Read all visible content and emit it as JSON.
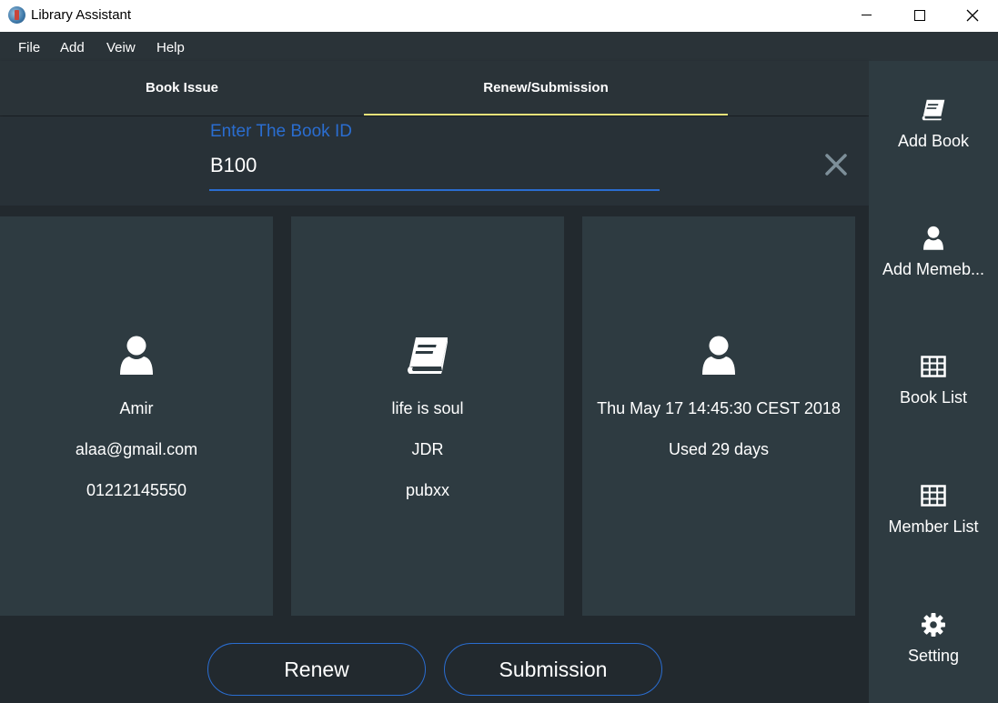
{
  "window": {
    "title": "Library Assistant"
  },
  "menu": {
    "file": "File",
    "add": "Add",
    "view": "Veiw",
    "help": "Help"
  },
  "tabs": {
    "issue": "Book Issue",
    "renew": "Renew/Submission",
    "active": "Renew/Submission"
  },
  "book_id": {
    "label": "Enter The Book ID",
    "value": "B100"
  },
  "member_card": {
    "icon": "user-icon",
    "name": "Amir",
    "email": "alaa@gmail.com",
    "phone": "01212145550"
  },
  "book_card": {
    "icon": "book-icon",
    "title": "life is soul",
    "author": "JDR",
    "publisher": "pubxx"
  },
  "issue_card": {
    "icon": "user-icon",
    "issue_date": "Thu May 17 14:45:30 CEST 2018",
    "days_used": "Used 29 days"
  },
  "buttons": {
    "renew": "Renew",
    "submission": "Submission"
  },
  "sidebar": {
    "items": [
      {
        "label": "Add Book",
        "icon": "book-icon"
      },
      {
        "label": "Add Memeb...",
        "icon": "user-icon"
      },
      {
        "label": "Book List",
        "icon": "table-icon"
      },
      {
        "label": "Member List",
        "icon": "table-icon"
      },
      {
        "label": "Setting",
        "icon": "gear-icon"
      }
    ]
  },
  "colors": {
    "accent": "#2a6dd0",
    "tab_indicator": "#e9e27a",
    "background": "#22292e",
    "card": "#2e3b41"
  }
}
